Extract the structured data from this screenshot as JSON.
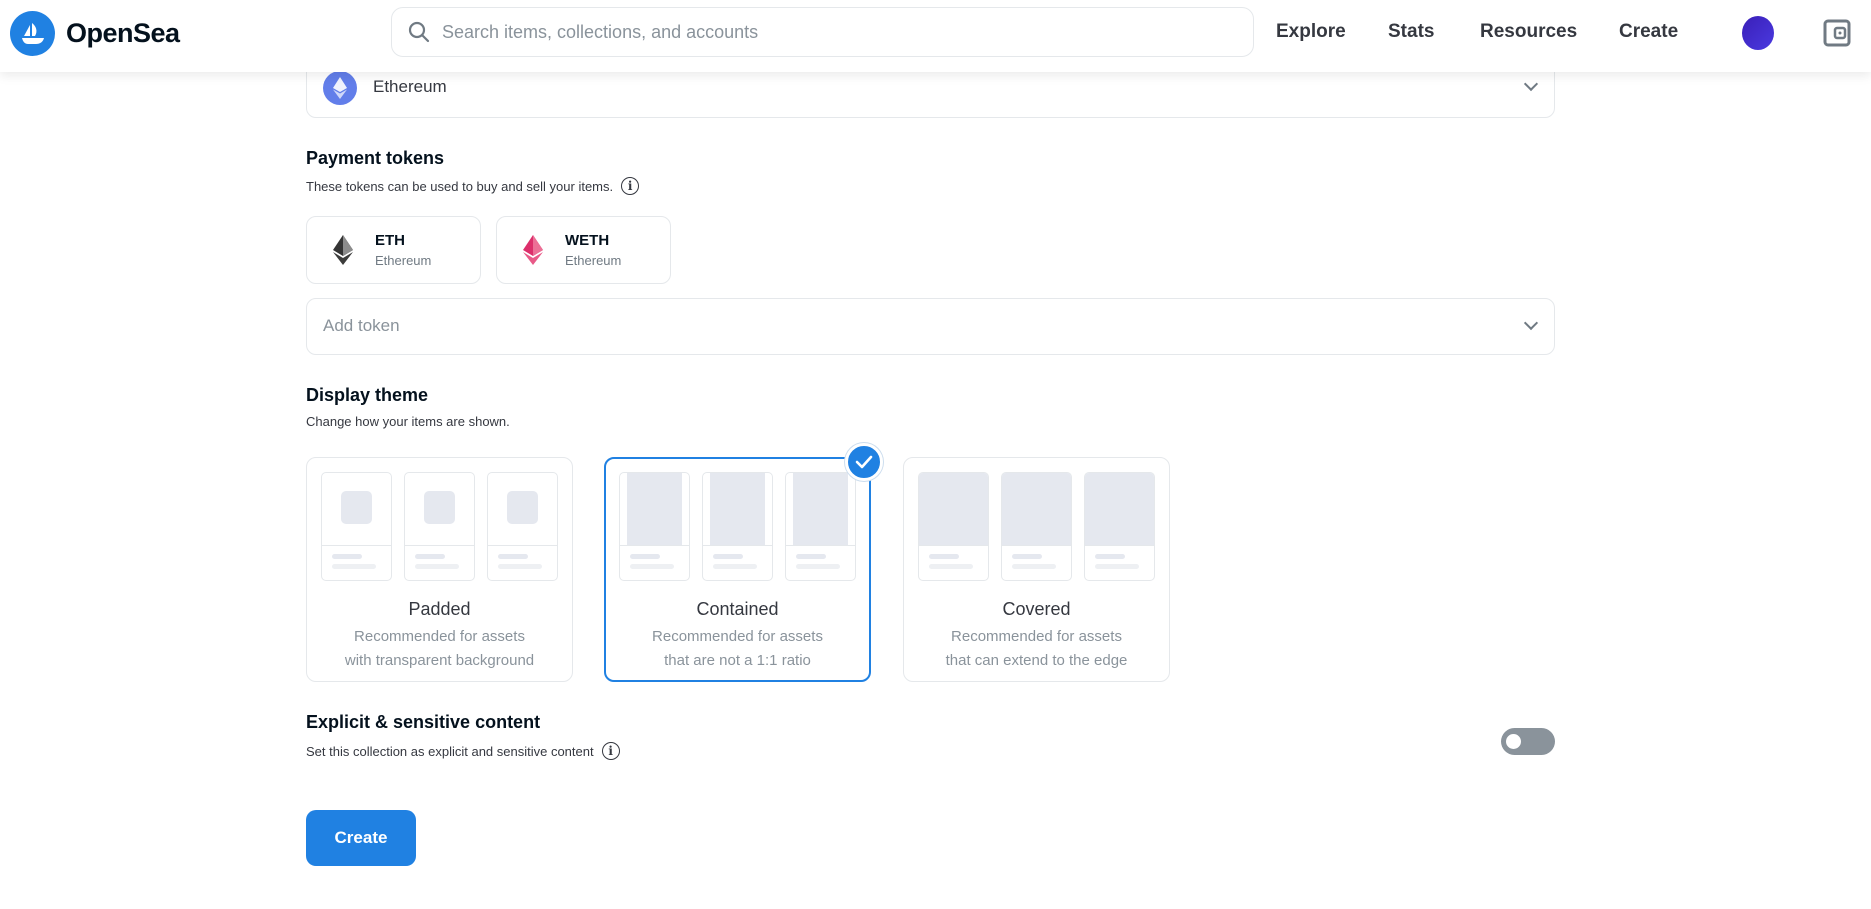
{
  "header": {
    "brand": "OpenSea",
    "search_placeholder": "Search items, collections, and accounts",
    "nav": [
      "Explore",
      "Stats",
      "Resources",
      "Create"
    ]
  },
  "blockchain": {
    "selected": "Ethereum"
  },
  "payment": {
    "title": "Payment tokens",
    "subtitle": "These tokens can be used to buy and sell your items.",
    "tokens": [
      {
        "symbol": "ETH",
        "network": "Ethereum"
      },
      {
        "symbol": "WETH",
        "network": "Ethereum"
      }
    ],
    "add_placeholder": "Add token"
  },
  "theme": {
    "title": "Display theme",
    "subtitle": "Change how your items are shown.",
    "options": [
      {
        "name": "Padded",
        "desc1": "Recommended for assets",
        "desc2": "with transparent background"
      },
      {
        "name": "Contained",
        "desc1": "Recommended for assets",
        "desc2": "that are not a 1:1 ratio",
        "selected": true
      },
      {
        "name": "Covered",
        "desc1": "Recommended for assets",
        "desc2": "that can extend to the edge"
      }
    ]
  },
  "explicit": {
    "title": "Explicit & sensitive content",
    "subtitle": "Set this collection as explicit and sensitive content",
    "enabled": false
  },
  "create_label": "Create",
  "colors": {
    "accent": "#2081e2",
    "toggle_off": "#8a939b"
  }
}
